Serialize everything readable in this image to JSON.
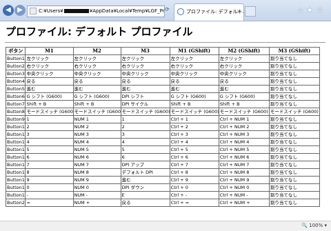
{
  "browser": {
    "address_prefix": "C:¥Users¥",
    "address_suffix": "¥AppData¥Local¥Temp¥LGF_Printo",
    "tab_title": "プロファイル: デフォルト…",
    "back_glyph": "◀",
    "forward_glyph": "▶",
    "tools": {
      "home": "⌂",
      "favorites": "★",
      "settings": "⚙"
    }
  },
  "page": {
    "title": "プロファイル: デフォルト プロファイル"
  },
  "table": {
    "headers": [
      "ボタン",
      "M1",
      "M2",
      "M3",
      "M1 (GShift)",
      "M2 (GShift)",
      "M3 (GShift)"
    ],
    "rows": [
      [
        "Button1",
        "左クリック",
        "左クリック",
        "左クリック",
        "左クリック",
        "左クリック",
        "割り当てなし"
      ],
      [
        "Button2",
        "右クリック",
        "右クリック",
        "右クリック",
        "右クリック",
        "右クリック",
        "割り当てなし"
      ],
      [
        "Button3",
        "中央クリック",
        "中央クリック",
        "中央クリック",
        "中央クリック",
        "中央クリック",
        "割り当てなし"
      ],
      [
        "Button4",
        "戻る",
        "戻る",
        "戻る",
        "戻る",
        "戻る",
        "割り当てなし"
      ],
      [
        "Button5",
        "進む",
        "進む",
        "進む",
        "進む",
        "進む",
        "割り当てなし"
      ],
      [
        "Button6",
        "G シフト (G600)",
        "G シフト (G600)",
        "DPI シフト",
        "G シフト (G600)",
        "G シフト (G600)",
        "割り当てなし"
      ],
      [
        "Button7",
        "Shift + B",
        "Shift + B",
        "DPI サイクル",
        "Shift + B",
        "Shift + B",
        "割り当てなし"
      ],
      [
        "Button8",
        "モードスイッチ (G600)",
        "モードスイッチ (G600)",
        "モードスイッチ (G600)",
        "モードスイッチ (G600)",
        "モードスイッチ (G600)",
        "モードスイッチ (G600)"
      ],
      [
        "Button9",
        "1",
        "NUM 1",
        "1",
        "Ctrl + 1",
        "Ctrl + NUM 1",
        "割り当てなし"
      ],
      [
        "Button10",
        "2",
        "NUM 2",
        "2",
        "Ctrl + 2",
        "Ctrl + NUM 2",
        "割り当てなし"
      ],
      [
        "Button11",
        "3",
        "NUM 3",
        "3",
        "Ctrl + 3",
        "Ctrl + NUM 3",
        "割り当てなし"
      ],
      [
        "Button12",
        "4",
        "NUM 4",
        "4",
        "Ctrl + 4",
        "Ctrl + NUM 4",
        "割り当てなし"
      ],
      [
        "Button13",
        "5",
        "NUM 5",
        "5",
        "Ctrl + 5",
        "Ctrl + NUM 5",
        "割り当てなし"
      ],
      [
        "Button14",
        "6",
        "NUM 6",
        "6",
        "Ctrl + 6",
        "Ctrl + NUM 6",
        "割り当てなし"
      ],
      [
        "Button15",
        "7",
        "NUM 7",
        "DPI アップ",
        "Ctrl + 7",
        "Ctrl + NUM 7",
        "割り当てなし"
      ],
      [
        "Button16",
        "8",
        "NUM 8",
        "デフォルト DPI",
        "Ctrl + 8",
        "Ctrl + NUM 8",
        "割り当てなし"
      ],
      [
        "Button17",
        "9",
        "NUM 9",
        "進む",
        "Ctrl + 9",
        "Ctrl + NUM 9",
        "割り当てなし"
      ],
      [
        "Button18",
        "0",
        "NUM 0",
        "DPI ダウン",
        "Ctrl + 0",
        "Ctrl + NUM 0",
        "割り当てなし"
      ],
      [
        "Button19",
        "-",
        "NUM -",
        "E",
        "Ctrl + -",
        "Ctrl + NUM -",
        "割り当てなし"
      ],
      [
        "Button20",
        "=",
        "NUM +",
        "戻る",
        "Ctrl + =",
        "Ctrl + NUM +",
        "割り当てなし"
      ]
    ]
  },
  "status": {
    "zoom": "🔍 100%",
    "zoom_menu": "▾"
  }
}
